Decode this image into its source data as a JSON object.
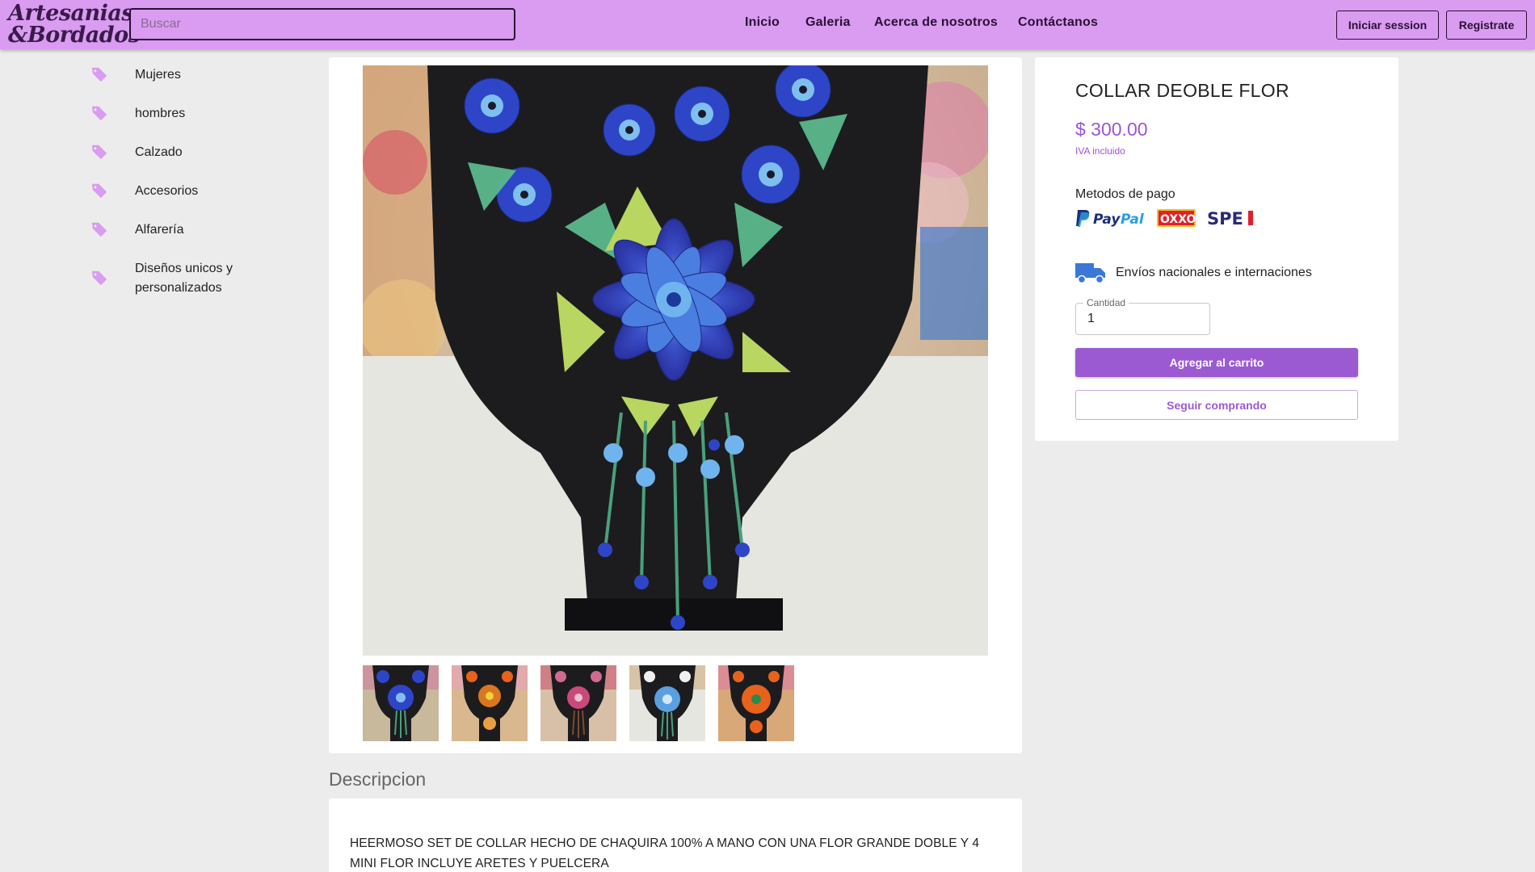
{
  "header": {
    "logo_line1": "Artesanias",
    "logo_line2": "&Bordados",
    "search_placeholder": "Buscar",
    "nav": [
      "Inicio",
      "Galeria",
      "Acerca de nosotros",
      "Contáctanos"
    ],
    "login_label": "Iniciar session",
    "register_label": "Registrate"
  },
  "sidebar": {
    "items": [
      {
        "label": "Mujeres",
        "icon": "tag-icon"
      },
      {
        "label": "hombres",
        "icon": "tag-icon"
      },
      {
        "label": "Calzado",
        "icon": "tag-icon"
      },
      {
        "label": "Accesorios",
        "icon": "tag-icon"
      },
      {
        "label": "Alfarería",
        "icon": "tag-icon"
      },
      {
        "label": "Diseños unicos y personalizados",
        "icon": "tag-icon"
      }
    ]
  },
  "product": {
    "title": "COLLAR DEOBLE FLOR",
    "price": "$ 300.00",
    "tax_note": "IVA incluido",
    "payment_title": "Metodos de pago",
    "payment_methods": [
      "PayPal",
      "OXXO",
      "SPEI"
    ],
    "shipping_text": "Envíos nacionales e internaciones",
    "quantity_label": "Cantidad",
    "quantity_value": "1",
    "add_to_cart_label": "Agregar al carrito",
    "continue_label": "Seguir comprando",
    "thumbnails": [
      {
        "name": "thumb-blue-necklace",
        "accent": "#2d3fb0"
      },
      {
        "name": "thumb-orange-necklace",
        "accent": "#d9781e"
      },
      {
        "name": "thumb-pink-necklace",
        "accent": "#c94a7a"
      },
      {
        "name": "thumb-lightblue-necklace",
        "accent": "#5aa0e0"
      },
      {
        "name": "thumb-orange-flower-necklace",
        "accent": "#e8621c"
      }
    ]
  },
  "description": {
    "title": "Descripcion",
    "text": "HEERMOSO SET DE COLLAR HECHO DE CHAQUIRA 100% A MANO CON UNA FLOR GRANDE DOBLE Y 4 MINI FLOR INCLUYE ARETES Y PUELCERA"
  },
  "colors": {
    "header_bg": "#d99cf0",
    "accent": "#9c5ad2",
    "tag_icon": "#d99cf0"
  }
}
